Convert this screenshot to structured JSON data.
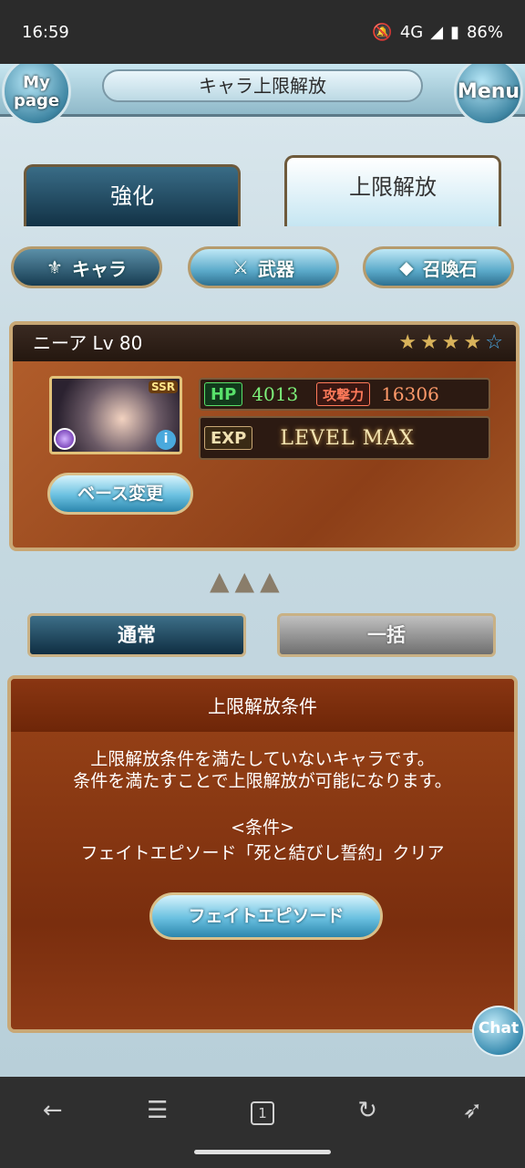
{
  "status": {
    "time": "16:59",
    "network": "4G",
    "battery": "86%"
  },
  "header": {
    "title": "キャラ上限解放",
    "mypage_label": "My page",
    "menu_label": "Menu"
  },
  "tabs": [
    {
      "label": "強化"
    },
    {
      "label": "上限解放"
    }
  ],
  "categories": [
    {
      "label": "キャラ"
    },
    {
      "label": "武器"
    },
    {
      "label": "召喚石"
    }
  ],
  "character": {
    "name_level": "ニーア Lv 80",
    "rarity": "SSR",
    "stars_filled": 4,
    "stars_total": 5,
    "hp_label": "HP",
    "hp": "4013",
    "atk_label": "攻撃力",
    "atk": "16306",
    "exp_label": "EXP",
    "exp_value": "LEVEL MAX",
    "base_change": "ベース変更"
  },
  "modes": [
    {
      "label": "通常"
    },
    {
      "label": "一括"
    }
  ],
  "conditions": {
    "title": "上限解放条件",
    "line1": "上限解放条件を満たしていないキャラです。",
    "line2": "条件を満たすことで上限解放が可能になります。",
    "heading": "<条件>",
    "detail": "フェイトエピソード「死と結びし誓約」クリア",
    "button": "フェイトエピソード"
  },
  "chat_label": "Chat",
  "navbar": {
    "tab_count": "1"
  }
}
